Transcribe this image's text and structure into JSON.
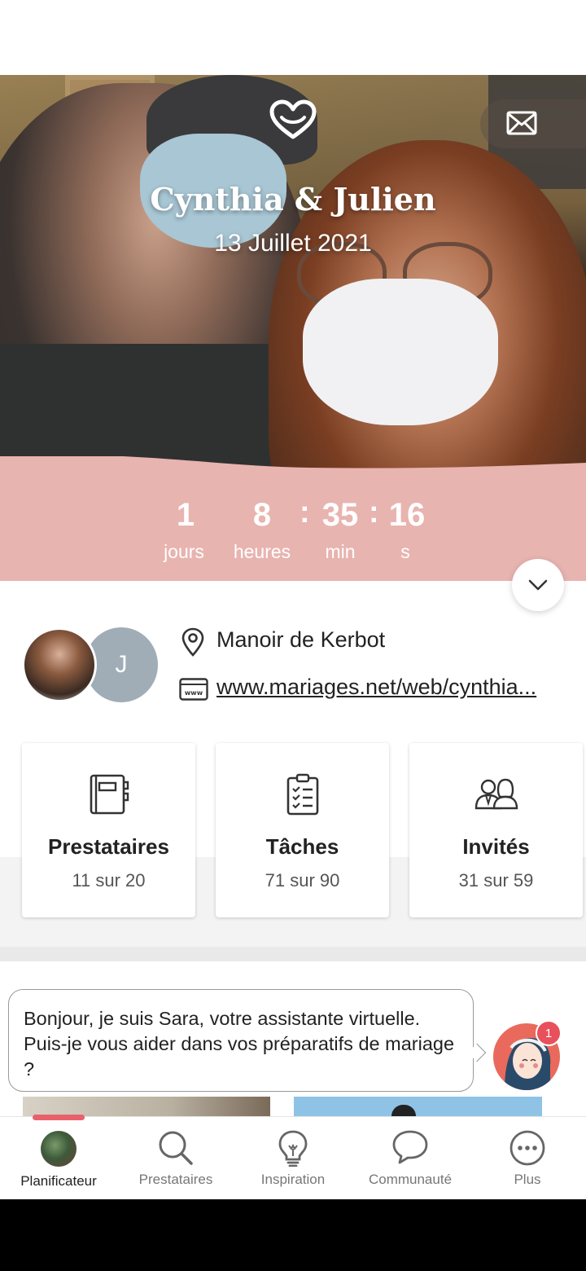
{
  "header": {
    "couple_name": "Cynthia & Julien",
    "wedding_date": "13 Juillet 2021"
  },
  "countdown": {
    "days": "1",
    "days_label": "jours",
    "hours": "8",
    "hours_label": "heures",
    "separator": ":",
    "minutes": "35",
    "minutes_label": "min",
    "seconds": "16",
    "seconds_label": "s"
  },
  "profile": {
    "groom_initial": "J",
    "venue": "Manoir de Kerbot",
    "website": "www.mariages.net/web/cynthia..."
  },
  "cards": [
    {
      "title": "Prestataires",
      "count": "11 sur 20",
      "icon": "notebook-icon"
    },
    {
      "title": "Tâches",
      "count": "71 sur 90",
      "icon": "checklist-icon"
    },
    {
      "title": "Invités",
      "count": "31 sur 59",
      "icon": "guests-icon"
    }
  ],
  "assistant": {
    "message": "Bonjour, je suis Sara, votre assistante virtuelle. Puis-je vous aider dans vos préparatifs de mariage ?",
    "badge": "1"
  },
  "tabs": [
    {
      "label": "Planificateur",
      "icon": "avatar-icon",
      "active": true
    },
    {
      "label": "Prestataires",
      "icon": "search-icon"
    },
    {
      "label": "Inspiration",
      "icon": "lightbulb-icon"
    },
    {
      "label": "Communauté",
      "icon": "chat-bubble-icon"
    },
    {
      "label": "Plus",
      "icon": "more-icon"
    }
  ],
  "colors": {
    "accent_pink": "#e8b4b0",
    "tab_indicator": "#e8616a",
    "badge": "#e8505b"
  }
}
